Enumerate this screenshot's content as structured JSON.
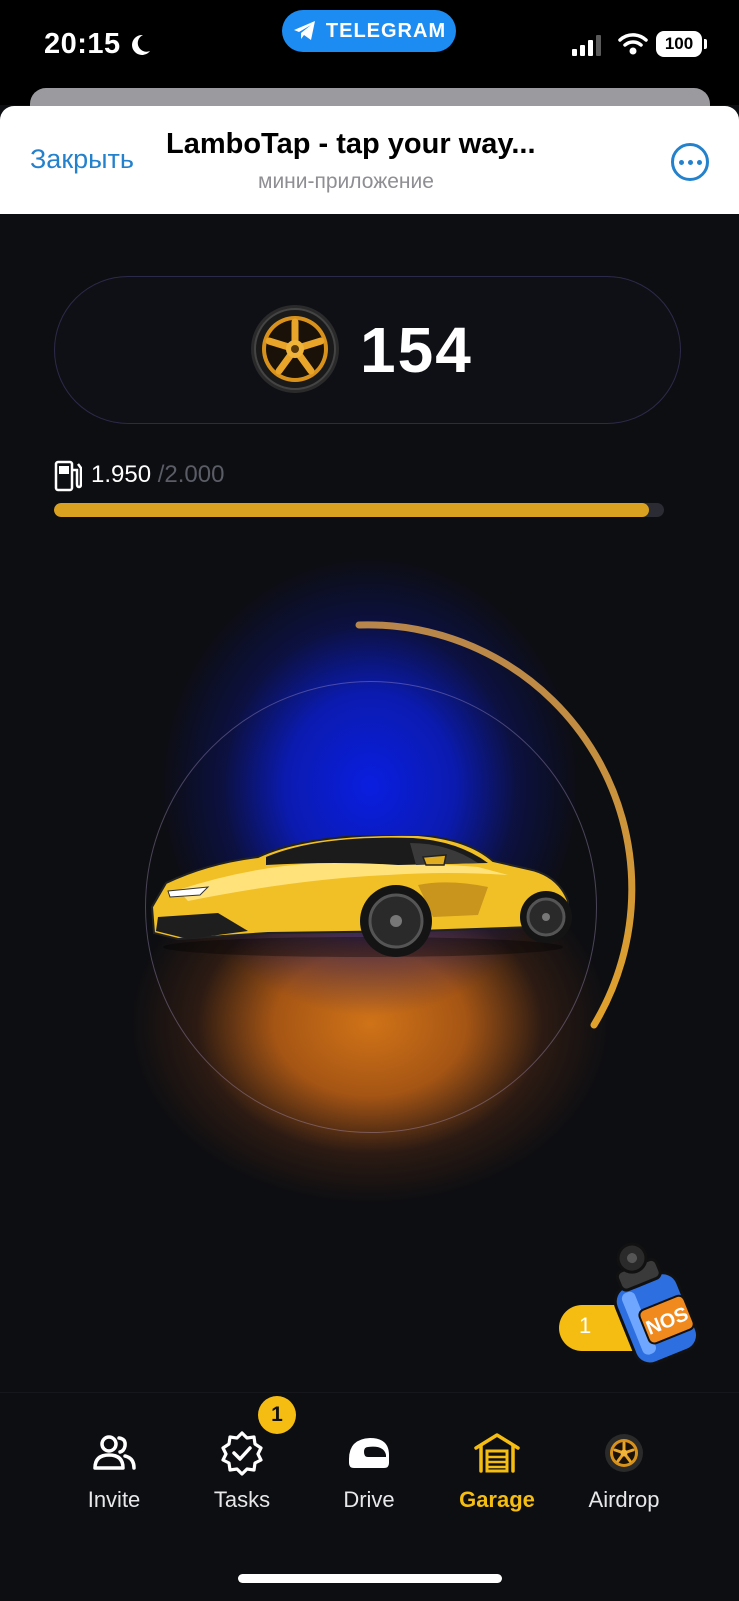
{
  "status_bar": {
    "time": "20:15",
    "telegram_label": "TELEGRAM",
    "battery": "100"
  },
  "header": {
    "close_label": "Закрыть",
    "title": "LamboTap - tap your way...",
    "subtitle": "мини-приложение"
  },
  "balance": "154",
  "fuel": {
    "current": "1.950",
    "max": "/2.000",
    "fraction": 0.975
  },
  "nitro": {
    "count": "1"
  },
  "nav": {
    "items": [
      {
        "label": "Invite",
        "icon": "users-icon"
      },
      {
        "label": "Tasks",
        "icon": "badge-check-icon",
        "badge": "1"
      },
      {
        "label": "Drive",
        "icon": "helmet-icon"
      },
      {
        "label": "Garage",
        "icon": "garage-icon",
        "active": true
      },
      {
        "label": "Airdrop",
        "icon": "wheel-coin-icon"
      }
    ]
  },
  "colors": {
    "accent": "#f5bd12",
    "fuel_bar": "#d9a11f",
    "telegram_blue": "#2481cc",
    "background": "#0d0e12"
  }
}
